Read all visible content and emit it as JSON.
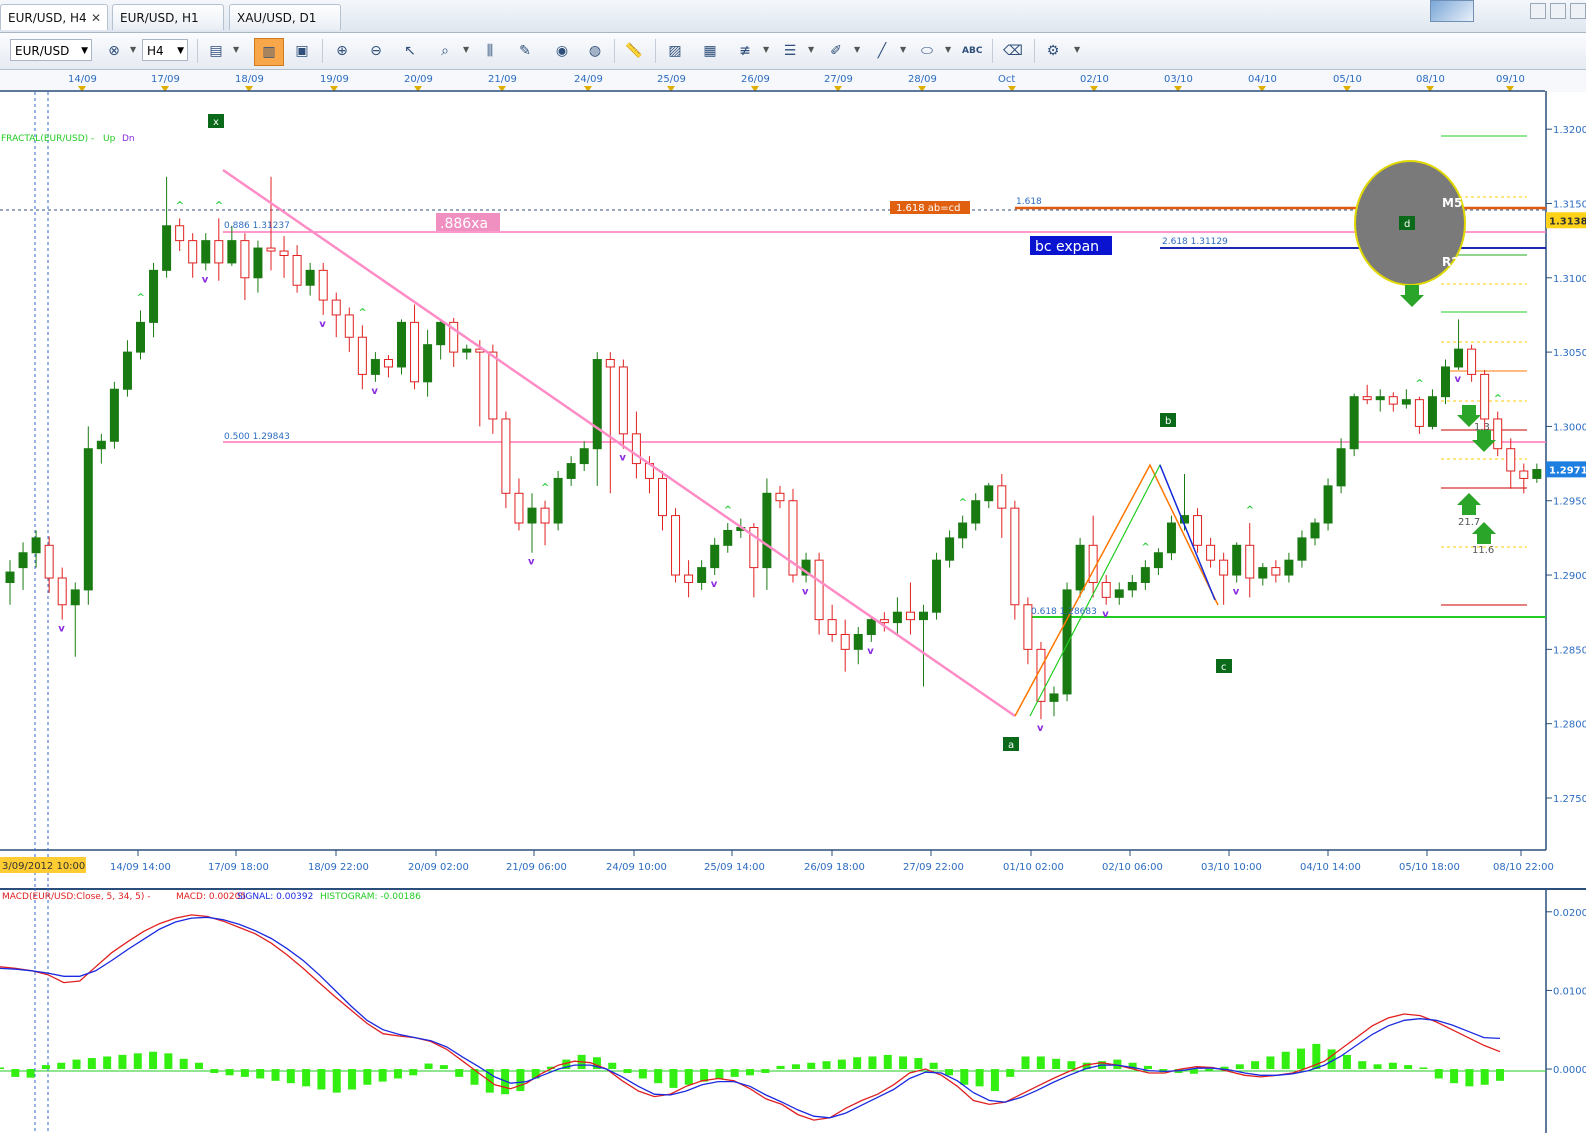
{
  "tabs": [
    {
      "label": "EUR/USD, H4"
    },
    {
      "label": "EUR/USD, H1"
    },
    {
      "label": "XAU/USD, D1"
    }
  ],
  "toolbar": {
    "symbol": "EUR/USD",
    "timeframe": "H4",
    "icons": [
      "chart-type-icon",
      "crosshair-icon",
      "zoom-icon",
      "cursor-icon",
      "magnify-icon",
      "vertical-line-icon",
      "edit-icon",
      "eye-icon",
      "globe-icon",
      "ruler-icon",
      "picture-icon",
      "template-icon",
      "fibonacci-icon",
      "channel-icon",
      "pen-icon",
      "trendline-icon",
      "ellipse-icon",
      "text-icon",
      "eraser-icon",
      "indicators-icon"
    ]
  },
  "chart_data": [
    {
      "type": "candlestick",
      "symbol": "EUR/USD",
      "timeframe": "H4",
      "ylim": [
        1.2715,
        1.3225
      ],
      "yticks": [
        "1.3200",
        "1.3150",
        "1.3100",
        "1.3050",
        "1.3000",
        "1.2950",
        "1.2900",
        "1.2850",
        "1.2800",
        "1.2750"
      ],
      "top_dates": [
        "14/09",
        "17/09",
        "18/09",
        "19/09",
        "20/09",
        "21/09",
        "24/09",
        "25/09",
        "26/09",
        "27/09",
        "28/09",
        "Oct",
        "02/10",
        "03/10",
        "04/10",
        "05/10",
        "08/10",
        "09/10"
      ],
      "bottom_times": [
        "3/09/2012 10:00",
        "14/09 14:00",
        "17/09 18:00",
        "18/09 22:00",
        "20/09 02:00",
        "21/09 06:00",
        "24/09 10:00",
        "25/09 14:00",
        "26/09 18:00",
        "27/09 22:00",
        "01/10 02:00",
        "02/10 06:00",
        "03/10 10:00",
        "04/10 14:00",
        "05/10 18:00",
        "08/10 22:00"
      ],
      "price_labels": {
        "current": "1.29711",
        "level": "1.31387"
      },
      "indicator_label": {
        "text": "FRACTAL(EUR/USD) -",
        "up": "Up",
        "dn": "Dn"
      },
      "candles": [
        [
          1.2895,
          1.2902,
          1.288,
          1.291
        ],
        [
          1.2905,
          1.2915,
          1.289,
          1.2922
        ],
        [
          1.2915,
          1.2925,
          1.2905,
          1.293
        ],
        [
          1.292,
          1.2898,
          1.2888,
          1.2926
        ],
        [
          1.2898,
          1.288,
          1.287,
          1.2905
        ],
        [
          1.288,
          1.289,
          1.2845,
          1.2895
        ],
        [
          1.289,
          1.2985,
          1.288,
          1.3
        ],
        [
          1.2985,
          1.299,
          1.2975,
          1.2995
        ],
        [
          1.299,
          1.3025,
          1.2985,
          1.303
        ],
        [
          1.3025,
          1.305,
          1.302,
          1.3058
        ],
        [
          1.305,
          1.307,
          1.3045,
          1.3078
        ],
        [
          1.307,
          1.3105,
          1.306,
          1.311
        ],
        [
          1.3105,
          1.3135,
          1.31,
          1.3168
        ],
        [
          1.3135,
          1.3125,
          1.3118,
          1.314
        ],
        [
          1.3125,
          1.311,
          1.31,
          1.313
        ],
        [
          1.311,
          1.3125,
          1.3105,
          1.313
        ],
        [
          1.3125,
          1.311,
          1.3098,
          1.314
        ],
        [
          1.311,
          1.3125,
          1.3108,
          1.3135
        ],
        [
          1.3125,
          1.31,
          1.3085,
          1.313
        ],
        [
          1.31,
          1.312,
          1.309,
          1.3125
        ],
        [
          1.312,
          1.3118,
          1.3105,
          1.3168
        ],
        [
          1.3118,
          1.3115,
          1.31,
          1.3128
        ],
        [
          1.3115,
          1.3095,
          1.309,
          1.3122
        ],
        [
          1.3095,
          1.3105,
          1.3088,
          1.311
        ],
        [
          1.3105,
          1.3085,
          1.3075,
          1.311
        ],
        [
          1.3085,
          1.3075,
          1.306,
          1.309
        ],
        [
          1.3075,
          1.306,
          1.305,
          1.308
        ],
        [
          1.306,
          1.3035,
          1.3025,
          1.3068
        ],
        [
          1.3035,
          1.3045,
          1.303,
          1.305
        ],
        [
          1.3045,
          1.304,
          1.3033,
          1.3048
        ],
        [
          1.304,
          1.307,
          1.3035,
          1.3072
        ],
        [
          1.307,
          1.303,
          1.3025,
          1.3082
        ],
        [
          1.303,
          1.3055,
          1.302,
          1.3065
        ],
        [
          1.3055,
          1.307,
          1.3045,
          1.3072
        ],
        [
          1.307,
          1.305,
          1.304,
          1.3073
        ],
        [
          1.305,
          1.3052,
          1.3045,
          1.3055
        ],
        [
          1.3052,
          1.305,
          1.3,
          1.3058
        ],
        [
          1.305,
          1.3005,
          1.2995,
          1.3055
        ],
        [
          1.3005,
          1.2955,
          1.2945,
          1.301
        ],
        [
          1.2955,
          1.2935,
          1.293,
          1.2965
        ],
        [
          1.2935,
          1.2945,
          1.2915,
          1.2955
        ],
        [
          1.2945,
          1.2935,
          1.292,
          1.295
        ],
        [
          1.2935,
          1.2965,
          1.293,
          1.297
        ],
        [
          1.2965,
          1.2975,
          1.296,
          1.298
        ],
        [
          1.2975,
          1.2985,
          1.297,
          1.299
        ],
        [
          1.2985,
          1.3045,
          1.296,
          1.305
        ],
        [
          1.3045,
          1.304,
          1.2955,
          1.305
        ],
        [
          1.304,
          1.2995,
          1.2985,
          1.3045
        ],
        [
          1.2995,
          1.2975,
          1.2965,
          1.301
        ],
        [
          1.2975,
          1.2965,
          1.2955,
          1.298
        ],
        [
          1.2965,
          1.294,
          1.293,
          1.297
        ],
        [
          1.294,
          1.29,
          1.2895,
          1.2945
        ],
        [
          1.29,
          1.2895,
          1.2885,
          1.291
        ],
        [
          1.2895,
          1.2905,
          1.289,
          1.291
        ],
        [
          1.2905,
          1.292,
          1.29,
          1.2925
        ],
        [
          1.292,
          1.293,
          1.2915,
          1.2935
        ],
        [
          1.293,
          1.2932,
          1.2925,
          1.2938
        ],
        [
          1.2932,
          1.2905,
          1.2885,
          1.2935
        ],
        [
          1.2905,
          1.2955,
          1.289,
          1.2965
        ],
        [
          1.2955,
          1.295,
          1.2945,
          1.296
        ],
        [
          1.295,
          1.29,
          1.2895,
          1.2958
        ],
        [
          1.29,
          1.291,
          1.2895,
          1.2915
        ],
        [
          1.291,
          1.287,
          1.286,
          1.2915
        ],
        [
          1.287,
          1.286,
          1.2855,
          1.288
        ],
        [
          1.286,
          1.285,
          1.2835,
          1.287
        ],
        [
          1.285,
          1.286,
          1.284,
          1.2865
        ],
        [
          1.286,
          1.287,
          1.2855,
          1.2872
        ],
        [
          1.287,
          1.2868,
          1.2862,
          1.2875
        ],
        [
          1.2868,
          1.2875,
          1.286,
          1.2885
        ],
        [
          1.2875,
          1.287,
          1.286,
          1.2895
        ],
        [
          1.287,
          1.2875,
          1.2825,
          1.288
        ],
        [
          1.2875,
          1.291,
          1.287,
          1.2915
        ],
        [
          1.291,
          1.2925,
          1.2905,
          1.293
        ],
        [
          1.2925,
          1.2935,
          1.2918,
          1.294
        ],
        [
          1.2935,
          1.295,
          1.293,
          1.2955
        ],
        [
          1.295,
          1.296,
          1.2945,
          1.2962
        ],
        [
          1.296,
          1.2945,
          1.2925,
          1.2968
        ],
        [
          1.2945,
          1.288,
          1.287,
          1.295
        ],
        [
          1.288,
          1.285,
          1.284,
          1.2885
        ],
        [
          1.285,
          1.2815,
          1.2803,
          1.2855
        ],
        [
          1.2815,
          1.282,
          1.2805,
          1.2825
        ],
        [
          1.282,
          1.289,
          1.2815,
          1.2895
        ],
        [
          1.289,
          1.292,
          1.2885,
          1.2925
        ],
        [
          1.292,
          1.2895,
          1.2885,
          1.294
        ],
        [
          1.2895,
          1.2885,
          1.288,
          1.29
        ],
        [
          1.2885,
          1.289,
          1.288,
          1.2895
        ],
        [
          1.289,
          1.2895,
          1.2885,
          1.29
        ],
        [
          1.2895,
          1.2905,
          1.289,
          1.291
        ],
        [
          1.2905,
          1.2915,
          1.29,
          1.2918
        ],
        [
          1.2915,
          1.2935,
          1.291,
          1.294
        ],
        [
          1.2935,
          1.294,
          1.293,
          1.2968
        ],
        [
          1.294,
          1.292,
          1.2915,
          1.2945
        ],
        [
          1.292,
          1.291,
          1.2905,
          1.2925
        ],
        [
          1.291,
          1.29,
          1.288,
          1.2915
        ],
        [
          1.29,
          1.292,
          1.2895,
          1.2922
        ],
        [
          1.292,
          1.2898,
          1.2885,
          1.2935
        ],
        [
          1.2898,
          1.2905,
          1.2893,
          1.2908
        ],
        [
          1.2905,
          1.29,
          1.2895,
          1.291
        ],
        [
          1.29,
          1.291,
          1.2895,
          1.2915
        ],
        [
          1.291,
          1.2925,
          1.2905,
          1.293
        ],
        [
          1.2925,
          1.2935,
          1.292,
          1.2938
        ],
        [
          1.2935,
          1.296,
          1.293,
          1.2965
        ],
        [
          1.296,
          1.2985,
          1.2955,
          1.2992
        ],
        [
          1.2985,
          1.302,
          1.298,
          1.3022
        ],
        [
          1.302,
          1.3018,
          1.3015,
          1.3028
        ],
        [
          1.3018,
          1.302,
          1.301,
          1.3025
        ],
        [
          1.302,
          1.3015,
          1.301,
          1.3023
        ],
        [
          1.3015,
          1.3018,
          1.3012,
          1.3025
        ],
        [
          1.3018,
          1.3,
          1.2995,
          1.302
        ],
        [
          1.3,
          1.302,
          1.2998,
          1.3025
        ],
        [
          1.302,
          1.304,
          1.3015,
          1.3045
        ],
        [
          1.304,
          1.3052,
          1.3038,
          1.3072
        ],
        [
          1.3052,
          1.3035,
          1.303,
          1.3055
        ],
        [
          1.3035,
          1.3005,
          1.2995,
          1.3038
        ],
        [
          1.3005,
          1.2985,
          1.298,
          1.301
        ],
        [
          1.2985,
          1.297,
          1.2958,
          1.2992
        ],
        [
          1.297,
          1.2965,
          1.2955,
          1.2975
        ],
        [
          1.2965,
          1.2971,
          1.2962,
          1.2975
        ]
      ],
      "annotations": {
        "points": [
          "x",
          "a",
          "b",
          "c",
          "d"
        ],
        "texts": [
          ".886xa",
          "bc expan",
          "1.618 ab=cd",
          "1.618",
          "2.618 1.31129",
          "0.886 1.31237",
          "0.500 1.29843",
          "0.618 1.28683",
          "M5",
          "R2",
          "1.3",
          "21.7",
          "11.6"
        ]
      },
      "colors": {
        "bull": "#1a7a12",
        "bear": "#e02020",
        "pattern": "#ff8cc6",
        "fractal_up": "#2ecc40",
        "fractal_dn": "#8a2be2"
      }
    },
    {
      "type": "macd",
      "legend": {
        "prefix": "MACD(EUR/USD:Close, 5, 34, 5) -",
        "macd": "MACD: 0.00205",
        "signal": "SIGNAL: 0.00392",
        "histogram": "HISTOGRAM: -0.00186"
      },
      "yticks": [
        "0.02000",
        "0.01000",
        "0.00000"
      ],
      "ylim": [
        -0.0075,
        0.0215
      ],
      "series": [
        {
          "name": "MACD",
          "color": "#e02020",
          "values": [
            0.013,
            0.0128,
            0.0125,
            0.012,
            0.011,
            0.0112,
            0.013,
            0.0148,
            0.0162,
            0.0175,
            0.0185,
            0.0192,
            0.0196,
            0.0194,
            0.0188,
            0.018,
            0.0172,
            0.016,
            0.0145,
            0.0128,
            0.011,
            0.0092,
            0.0075,
            0.0058,
            0.0045,
            0.0042,
            0.004,
            0.0035,
            0.0025,
            0.001,
            -0.0005,
            -0.002,
            -0.0025,
            -0.0018,
            -0.0005,
            0.0005,
            0.001,
            0.0008,
            0.0,
            -0.0015,
            -0.0028,
            -0.0035,
            -0.0032,
            -0.0022,
            -0.0015,
            -0.0012,
            -0.0015,
            -0.0025,
            -0.0038,
            -0.0045,
            -0.0058,
            -0.0065,
            -0.0062,
            -0.005,
            -0.004,
            -0.0032,
            -0.002,
            -0.0005,
            0.0,
            -0.0008,
            -0.0022,
            -0.004,
            -0.0045,
            -0.0042,
            -0.0032,
            -0.0022,
            -0.0012,
            -0.0003,
            0.0005,
            0.0008,
            0.0005,
            0.0,
            -0.0005,
            -0.0005,
            0.0,
            0.0003,
            0.0002,
            -0.0003,
            -0.0008,
            -0.001,
            -0.0008,
            -0.0005,
            0.0002,
            0.001,
            0.0025,
            0.004,
            0.0055,
            0.0065,
            0.007,
            0.0068,
            0.006,
            0.005,
            0.004,
            0.003,
            0.0022
          ]
        },
        {
          "name": "SIGNAL",
          "color": "#1a2ae0",
          "values": [
            0.0128,
            0.0127,
            0.0125,
            0.0122,
            0.0118,
            0.0118,
            0.0125,
            0.0138,
            0.0152,
            0.0165,
            0.0178,
            0.0187,
            0.0192,
            0.0193,
            0.019,
            0.0184,
            0.0176,
            0.0166,
            0.0153,
            0.0138,
            0.012,
            0.01,
            0.008,
            0.0062,
            0.005,
            0.0044,
            0.004,
            0.0036,
            0.0028,
            0.0015,
            0.0003,
            -0.001,
            -0.0018,
            -0.0016,
            -0.0008,
            0.0,
            0.0005,
            0.0005,
            0.0,
            -0.001,
            -0.0022,
            -0.0032,
            -0.0033,
            -0.0028,
            -0.002,
            -0.0016,
            -0.0016,
            -0.0022,
            -0.0033,
            -0.0042,
            -0.0052,
            -0.006,
            -0.0062,
            -0.0056,
            -0.0046,
            -0.0036,
            -0.0026,
            -0.0012,
            -0.0004,
            -0.0005,
            -0.0015,
            -0.003,
            -0.004,
            -0.0042,
            -0.0036,
            -0.0027,
            -0.0017,
            -0.0008,
            0.0,
            0.0005,
            0.0005,
            0.0002,
            -0.0002,
            -0.0003,
            -0.0002,
            0.0001,
            0.0001,
            -0.0001,
            -0.0005,
            -0.0008,
            -0.0008,
            -0.0006,
            -0.0002,
            0.0005,
            0.0016,
            0.003,
            0.0044,
            0.0055,
            0.0062,
            0.0064,
            0.0062,
            0.0056,
            0.0048,
            0.004,
            0.0039
          ]
        },
        {
          "name": "HISTOGRAM",
          "color": "#33ee11",
          "values": [
            0.0002,
            -0.001,
            -0.0011,
            0.0005,
            0.0008,
            0.0012,
            0.0014,
            0.0016,
            0.0018,
            0.002,
            0.0022,
            0.002,
            0.0013,
            0.0008,
            -0.0005,
            -0.0008,
            -0.001,
            -0.0012,
            -0.0015,
            -0.0018,
            -0.0022,
            -0.0026,
            -0.003,
            -0.0026,
            -0.002,
            -0.0016,
            -0.0012,
            -0.0008,
            0.0007,
            0.0005,
            -0.001,
            -0.002,
            -0.003,
            -0.0032,
            -0.0028,
            -0.0012,
            0.0003,
            0.0012,
            0.0018,
            0.0015,
            0.0008,
            -0.0005,
            -0.0012,
            -0.0018,
            -0.0024,
            -0.002,
            -0.0016,
            -0.0012,
            -0.001,
            -0.0008,
            -0.0005,
            0.0004,
            0.0006,
            0.0008,
            0.001,
            0.0012,
            0.0015,
            0.0016,
            0.0018,
            0.0016,
            0.0014,
            0.0008,
            -0.0008,
            -0.002,
            -0.0022,
            -0.0028,
            -0.001,
            0.0016,
            0.0016,
            0.0013,
            0.001,
            0.0008,
            0.001,
            0.0012,
            0.0008,
            0.0004,
            -0.0004,
            -0.0005,
            -0.0006,
            -0.0002,
            0.0003,
            0.0006,
            0.001,
            0.0016,
            0.0022,
            0.0026,
            0.0032,
            0.0025,
            0.0018,
            0.001,
            0.0006,
            0.0008,
            0.0005,
            0.0002,
            -0.0012,
            -0.0018,
            -0.0022,
            -0.002,
            -0.0015
          ]
        }
      ]
    }
  ]
}
